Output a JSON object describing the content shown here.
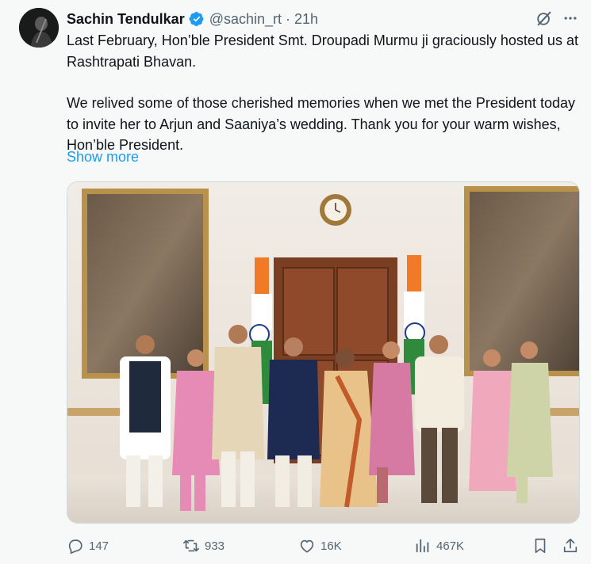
{
  "tweet": {
    "author_name": "Sachin Tendulkar",
    "handle": "@sachin_rt",
    "separator": "·",
    "time": "21h",
    "paragraphs": [
      "Last February, Hon’ble President Smt. Droupadi Murmu ji graciously hosted us at Rashtrapati Bhavan.",
      "We relived some of those cherished memories when we met the President today to invite her to Arjun and Saaniya’s wedding. Thank you for your warm wishes, Hon’ble President."
    ],
    "show_more": "Show more"
  },
  "actions": {
    "replies": "147",
    "reposts": "933",
    "likes": "16K",
    "views": "467K"
  },
  "icons": {
    "verified": "verified-badge-icon",
    "grok": "grok-icon",
    "more": "more-options-icon",
    "reply": "reply-icon",
    "repost": "repost-icon",
    "like": "heart-icon",
    "views": "views-bar-chart-icon",
    "bookmark": "bookmark-icon",
    "share": "share-icon"
  },
  "colors": {
    "accent": "#1d9bf0",
    "muted": "#536471",
    "text": "#0f1419",
    "background": "#f7f9f9"
  }
}
